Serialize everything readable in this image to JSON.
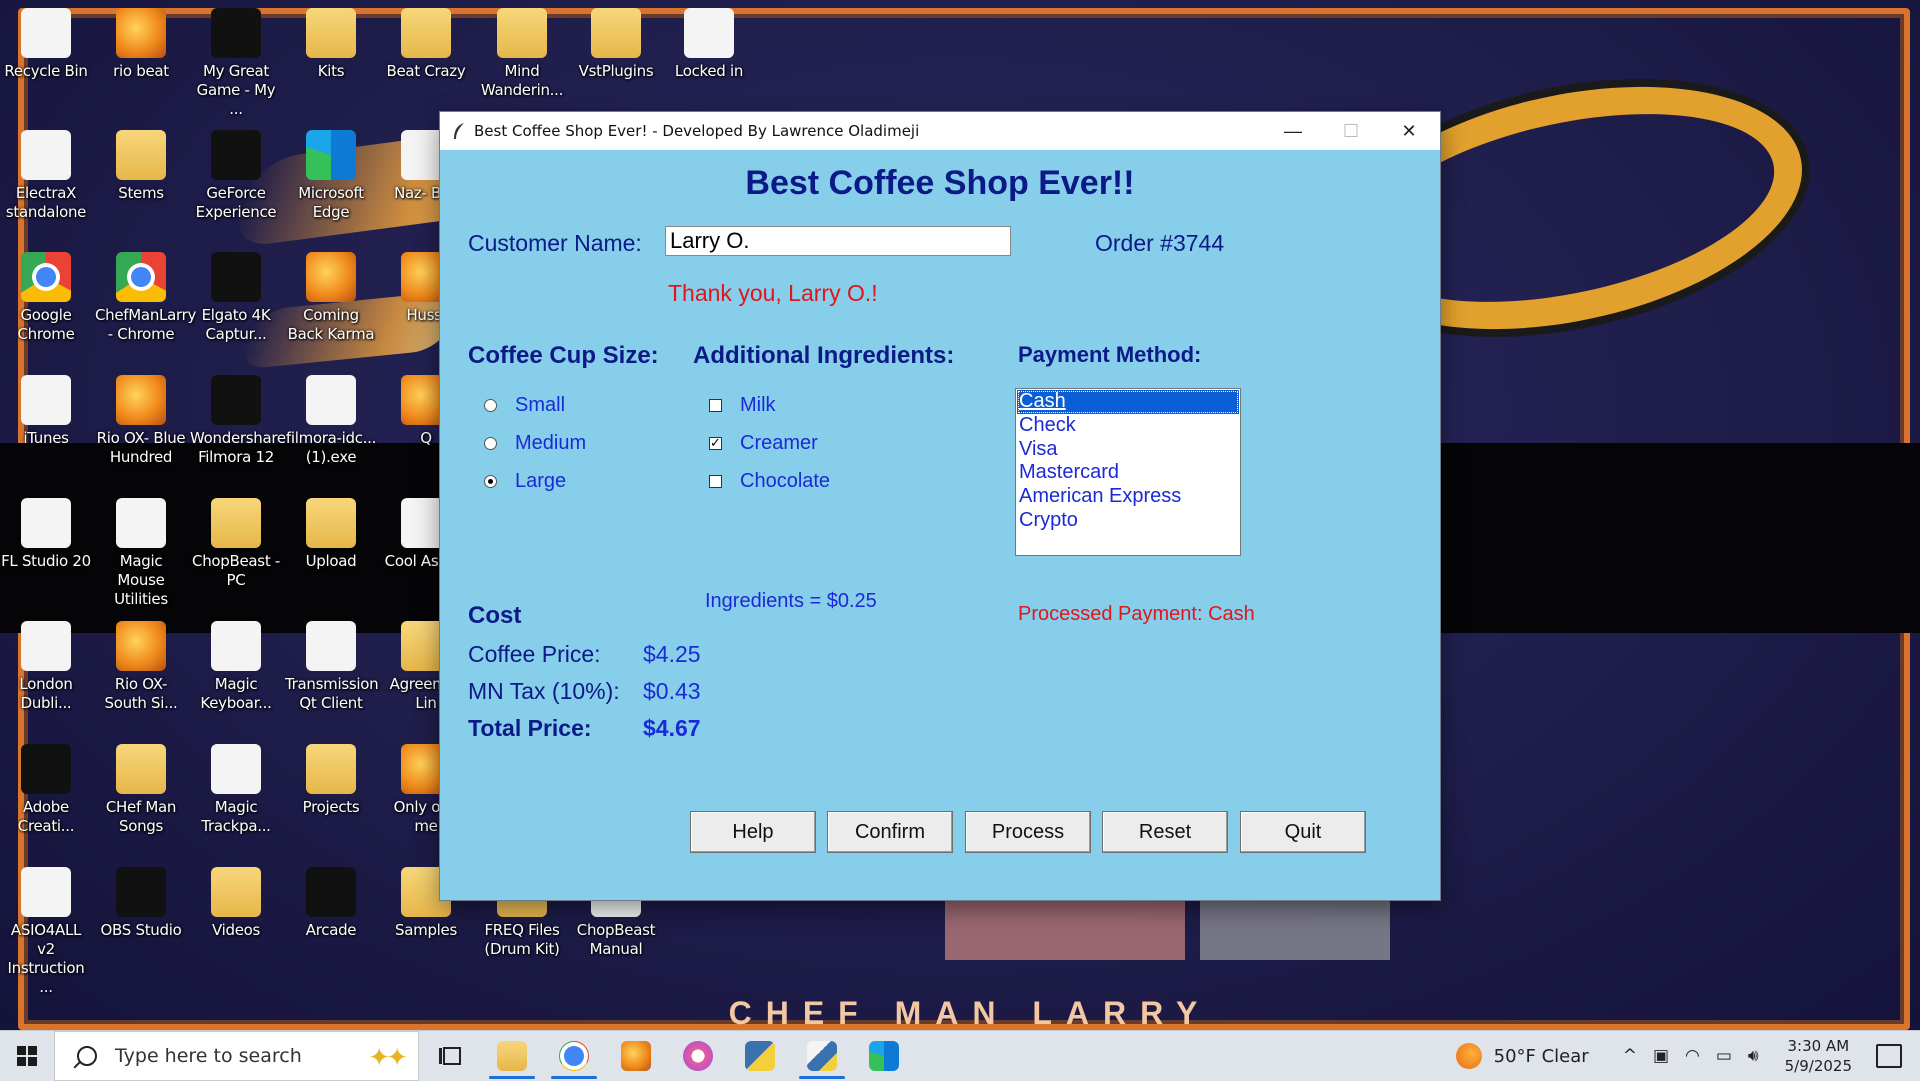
{
  "desktop": {
    "tagline": "CHEF MAN LARRY",
    "icons": [
      {
        "label": "Recycle Bin"
      },
      {
        "label": "rio beat"
      },
      {
        "label": "My Great Game - My ..."
      },
      {
        "label": "Kits"
      },
      {
        "label": "Beat Crazy"
      },
      {
        "label": "Mind Wanderin..."
      },
      {
        "label": "VstPlugins"
      },
      {
        "label": "Locked in"
      },
      {
        "label": "ElectraX standalone"
      },
      {
        "label": "Stems"
      },
      {
        "label": "GeForce Experience"
      },
      {
        "label": "Microsoft Edge"
      },
      {
        "label": "Naz- Bac"
      },
      {
        "label": "Google Chrome"
      },
      {
        "label": "ChefManLarry - Chrome"
      },
      {
        "label": "Elgato 4K Captur..."
      },
      {
        "label": "Coming Back Karma"
      },
      {
        "label": "Hussl"
      },
      {
        "label": "iTunes"
      },
      {
        "label": "Rio OX- Blue Hundred"
      },
      {
        "label": "Wondershare Filmora 12"
      },
      {
        "label": "filmora-idc... (1).exe"
      },
      {
        "label": "Q"
      },
      {
        "label": "FL Studio 20"
      },
      {
        "label": "Magic Mouse Utilities"
      },
      {
        "label": "ChopBeast - PC"
      },
      {
        "label": "Upload"
      },
      {
        "label": "Cool As Tag"
      },
      {
        "label": "London Dubli..."
      },
      {
        "label": "Rio OX- South Si..."
      },
      {
        "label": "Magic Keyboar..."
      },
      {
        "label": "Transmission Qt Client"
      },
      {
        "label": "Agreem & Lin"
      },
      {
        "label": "Adobe Creati..."
      },
      {
        "label": "CHef Man Songs"
      },
      {
        "label": "Magic Trackpa..."
      },
      {
        "label": "Projects"
      },
      {
        "label": "Only one me"
      },
      {
        "label": "ASIO4ALL v2 Instruction ..."
      },
      {
        "label": "OBS Studio"
      },
      {
        "label": "Videos"
      },
      {
        "label": "Arcade"
      },
      {
        "label": "Samples"
      },
      {
        "label": "FREQ Files (Drum Kit)"
      },
      {
        "label": "ChopBeast Manual"
      }
    ]
  },
  "window": {
    "title": "Best Coffee Shop Ever! - Developed By Lawrence Oladimeji",
    "controls": {
      "minimize": "—",
      "maximize": "☐",
      "close": "✕"
    }
  },
  "app": {
    "heading": "Best Coffee Shop Ever!!",
    "customer_label": "Customer Name:",
    "customer_value": "Larry O.",
    "order": "Order #3744",
    "thanks": "Thank you, Larry O.!",
    "cup_size_header": "Coffee Cup Size:",
    "sizes": [
      {
        "label": "Small",
        "selected": false
      },
      {
        "label": "Medium",
        "selected": false
      },
      {
        "label": "Large",
        "selected": true
      }
    ],
    "ingredients_header": "Additional Ingredients:",
    "ingredients": [
      {
        "label": "Milk",
        "checked": false
      },
      {
        "label": "Creamer",
        "checked": true
      },
      {
        "label": "Chocolate",
        "checked": false
      }
    ],
    "payment_header": "Payment Method:",
    "payment_options": [
      "Cash",
      "Check",
      "Visa",
      "Mastercard",
      "American Express",
      "Crypto"
    ],
    "payment_selected": "Cash",
    "ingredients_cost": "Ingredients = $0.25",
    "processed": "Processed Payment: Cash",
    "cost_header": "Cost",
    "coffee_price_label": "Coffee Price:",
    "coffee_price": "$4.25",
    "tax_label": "MN Tax (10%):",
    "tax": "$0.43",
    "total_label": "Total Price:",
    "total": "$4.67",
    "buttons": {
      "help": "Help",
      "confirm": "Confirm",
      "process": "Process",
      "reset": "Reset",
      "quit": "Quit"
    }
  },
  "taskbar": {
    "search_placeholder": "Type here to search",
    "weather": "50°F  Clear",
    "time": "3:30 AM",
    "date": "5/9/2025"
  },
  "colors": {
    "window_bg": "#87ceeb",
    "label_navy": "#0b1a86",
    "option_blue": "#1b2ad6",
    "alert_red": "#e0161b",
    "list_selection": "#0a5fd6"
  }
}
